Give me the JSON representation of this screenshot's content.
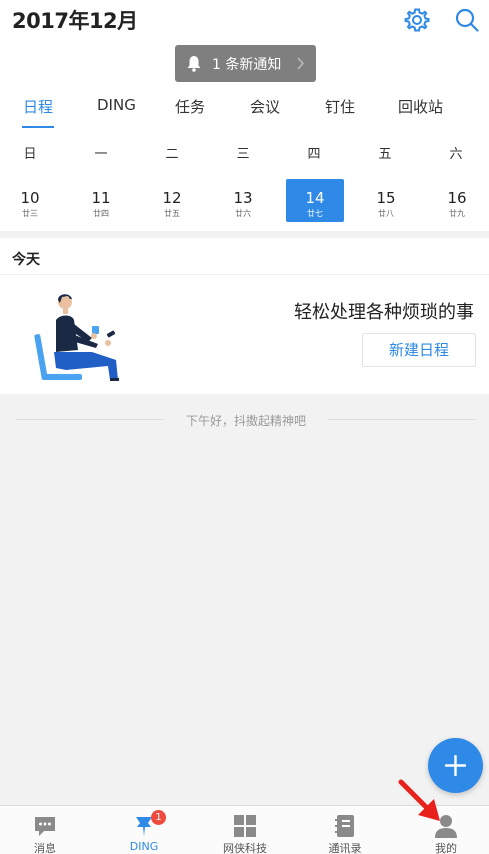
{
  "header": {
    "month_title": "2017年12月",
    "icons": [
      "gear-icon",
      "search-icon"
    ]
  },
  "notification": {
    "text": "1 条新通知",
    "icons": [
      "bell-icon",
      "chevron-right-icon"
    ]
  },
  "tabs": [
    {
      "label": "日程",
      "active": true
    },
    {
      "label": "DING",
      "active": false
    },
    {
      "label": "任务",
      "active": false
    },
    {
      "label": "会议",
      "active": false
    },
    {
      "label": "钉住",
      "active": false
    },
    {
      "label": "回收站",
      "active": false
    }
  ],
  "calendar": {
    "weekdays": [
      "日",
      "一",
      "二",
      "三",
      "四",
      "五",
      "六"
    ],
    "days": [
      {
        "num": "10",
        "lunar": "廿三"
      },
      {
        "num": "11",
        "lunar": "廿四"
      },
      {
        "num": "12",
        "lunar": "廿五"
      },
      {
        "num": "13",
        "lunar": "廿六"
      },
      {
        "num": "14",
        "lunar": "廿七",
        "selected": true
      },
      {
        "num": "15",
        "lunar": "廿八"
      },
      {
        "num": "16",
        "lunar": "廿九"
      }
    ]
  },
  "today": {
    "label": "今天",
    "slogan": "轻松处理各种烦琐的事",
    "new_button": "新建日程"
  },
  "greeting": "下午好，抖擞起精神吧",
  "fab": {
    "icon": "plus-icon"
  },
  "bottom_nav": [
    {
      "label": "消息",
      "icon": "chat-bubble-icon"
    },
    {
      "label": "DING",
      "icon": "pin-icon",
      "active": true,
      "badge": "1"
    },
    {
      "label": "网侠科技",
      "icon": "grid-icon"
    },
    {
      "label": "通讯录",
      "icon": "address-book-icon"
    },
    {
      "label": "我的",
      "icon": "person-icon"
    }
  ],
  "colors": {
    "accent": "#2e8ae6",
    "badge": "#f04a3e",
    "annotation_arrow": "#e8211b"
  }
}
